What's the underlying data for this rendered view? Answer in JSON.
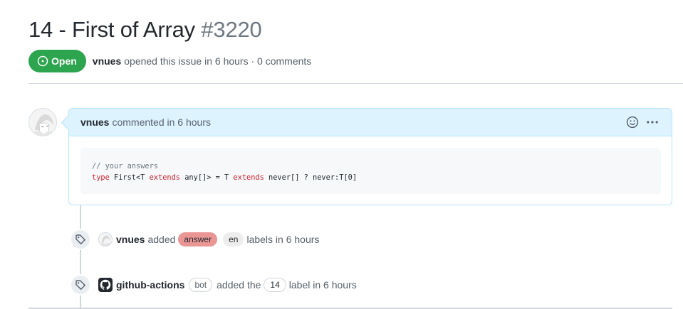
{
  "issue": {
    "title": "14 - First of Array",
    "number": "#3220",
    "state": "Open",
    "author": "vnues",
    "meta_text": "opened this issue in 6 hours · 0 comments"
  },
  "comment": {
    "author": "vnues",
    "action_text": "commented in 6 hours",
    "code_comment": "// your answers",
    "code_tokens": [
      {
        "type": "kw",
        "text": "type"
      },
      {
        "type": "plain",
        "text": " First<T "
      },
      {
        "type": "kw",
        "text": "extends"
      },
      {
        "type": "plain",
        "text": " any[]> = T "
      },
      {
        "type": "kw",
        "text": "extends"
      },
      {
        "type": "plain",
        "text": " never[] ? never:T[0]"
      }
    ]
  },
  "timeline": {
    "labels_event": {
      "author": "vnues",
      "verb": "added",
      "labels": [
        "answer",
        "en"
      ],
      "suffix": "labels in 6 hours"
    },
    "bot_event": {
      "author": "github-actions",
      "badge": "bot",
      "verb": "added the",
      "label": "14",
      "suffix": "label in 6 hours"
    }
  },
  "colors": {
    "open_green": "#2da44e",
    "comment_header_bg": "#ddf4ff",
    "label_answer": "#e99695",
    "label_en": "#ededed",
    "keyword_red": "#cf222e"
  },
  "icons": {
    "state": "issue-opened-icon",
    "reaction": "smiley-icon",
    "menu": "kebab-horizontal-icon",
    "label_event": "tag-icon",
    "bot_avatar": "github-logo-icon"
  }
}
